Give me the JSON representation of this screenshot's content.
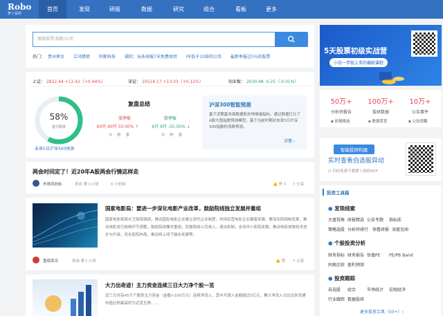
{
  "nav": {
    "logo": "Robo",
    "logo_sub": "萝卜投研",
    "items": [
      "首页",
      "发现",
      "研报",
      "数据",
      "研究",
      "组合",
      "看板",
      "更多"
    ]
  },
  "search": {
    "placeholder": "搜索股票/指数/公司"
  },
  "hot": {
    "label": "热门：",
    "items": [
      "贵州茅台",
      "立讯精密",
      "阿斯科技",
      "福利：玩永研报7天免费体验",
      "PE低于10倍的公司",
      "最新季报过5%的股票"
    ]
  },
  "indices": [
    {
      "name": "上证：",
      "value": "2822.44",
      "change": "+12.42（+0.44%）",
      "dir": "up"
    },
    {
      "name": "深证：",
      "value": "10514.17",
      "change": "+13.03（+0.12%）",
      "dir": "up"
    },
    {
      "name": "创业板：",
      "value": "2030.48",
      "change": "-0.25（-0.01%）",
      "dir": "down"
    }
  ],
  "review": {
    "gauge_value": 58,
    "gauge_value_text": "58%",
    "gauge_sub": "盈亏概率",
    "gauge_link": "未来5日沪深300预测",
    "title": "复盘总结",
    "up": {
      "label": "涨停板",
      "line": "60只 40只 50.00% ↑",
      "sub": "今    昨    率"
    },
    "down": {
      "label": "跌停板",
      "line": "6只 9只 -35.05% ↓",
      "sub": "今    昨    率"
    },
    "forecast_title": "沪深300智能预测",
    "forecast_text": "基于近期基本面数据和市场情绪指标，通过数据打分了A股大盘指数预测模型，基于当前时期对未来5日沪深300指数的涨跌预测。",
    "forecast_link": "详情 ›"
  },
  "posts": [
    {
      "title": "两会时间定了！近20年A股两会行情这样走",
      "author": "市场风向标",
      "source": "来自 萝卜小研",
      "time": "6 小时前",
      "likes": "赞 5",
      "share": "分享",
      "has_thumb": false
    },
    {
      "title": "国家电影局：要进一步深化电影产业改革，鼓励院线独立发展并重组",
      "body": "国家电影局局长王晓晖强调，推动国有电影企业建立现代企业制度，扶持民营电影企业健康发展。要深化院线制改革，推动电影发行放映环节调整，鼓励院线兼并重组，实施院线公司准入、退出机制，支持中小影院发展，推动电影放映技术进步与升级，优化影院布局，推动线上线下融合发展等。",
      "author": "重磅资讯",
      "source": "来自 萝卜小研",
      "time": "",
      "likes": "赞",
      "share": "分享",
      "has_thumb": true
    },
    {
      "title": "大力出奇迹！主力资金连续三日大力净个股一览",
      "body": "近三日共有45只个股获主力资金（金额>100万元）连续净流入，其中开源入金额超过5亿元，累计净流入占比达到流通市值比例最高的为迈克生物……",
      "has_thumb": true
    }
  ],
  "ad": {
    "title": "5天股票初级实战营",
    "sub": "小白一学就上手的爆款课程"
  },
  "stats": [
    {
      "num": "50万+",
      "label": "分析师报告",
      "tag": "研报精选"
    },
    {
      "num": "100万+",
      "label": "投研数据",
      "tag": "数据库查"
    },
    {
      "num": "10万+",
      "label": "公告事件",
      "tag": "公告提醒"
    }
  ],
  "app": {
    "button": "智能投研利器",
    "title": "实时查看自选股异动",
    "sub": "扫码免费下载萝卜投研APP"
  },
  "tools": {
    "header": "投资工具箱",
    "groups": [
      {
        "title": "发现线索",
        "rows": [
          [
            "大盘视角",
            "研报精选",
            "公告专题",
            "指标库"
          ],
          [
            "策略选股",
            "分析师排行",
            "快看研报",
            "深度见闻"
          ]
        ]
      },
      {
        "title": "个股投资分析",
        "rows": [
          [
            "财务指标",
            "财务报告",
            "估值PE",
            "PE/PB Band"
          ],
          [
            "同类比较",
            "盈利预测"
          ]
        ]
      },
      {
        "title": "投资跟踪",
        "rows": [
          [
            "自选股",
            "组合",
            "市场统计",
            "宏观经济"
          ],
          [
            "行业跟踪",
            "数据投研"
          ]
        ]
      }
    ],
    "more": "更多投资工具（50+）›"
  },
  "colors": {
    "nav": "#3471c1",
    "accent": "#3b8ae0",
    "up": "#e5484d",
    "down": "#2ba06d",
    "gauge": "#2fbf88"
  }
}
